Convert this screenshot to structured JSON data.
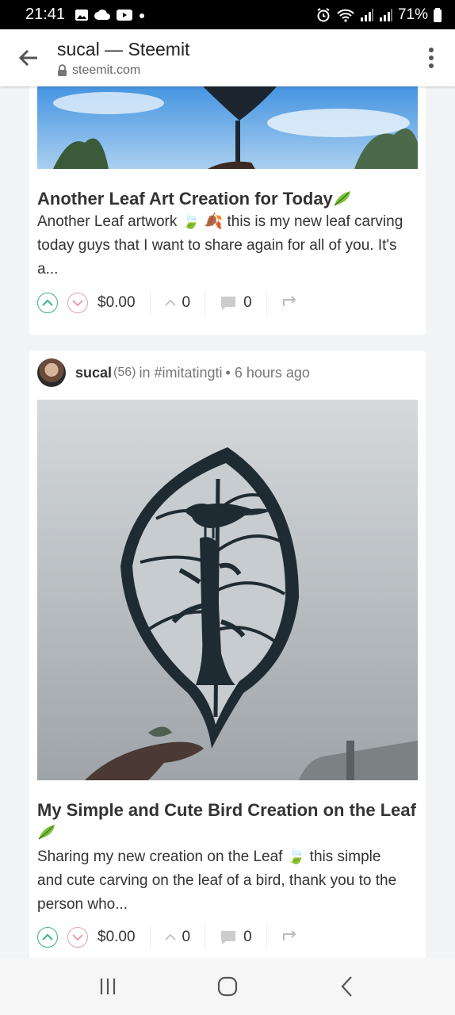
{
  "status_bar": {
    "time": "21:41",
    "battery": "71%"
  },
  "toolbar": {
    "title": "sucal — Steemit",
    "url": "steemit.com"
  },
  "posts": [
    {
      "title": "Another Leaf Art Creation for Today",
      "body": "Another Leaf artwork 🍃 🍂 this is my new leaf carving today guys that I want to share again for all of you. It's a...",
      "payout": "$0.00",
      "votes": "0",
      "comments": "0"
    },
    {
      "author": "sucal",
      "reputation": "(56)",
      "community": "in #imitatingti",
      "time": "• 6 hours ago",
      "title": "My Simple and Cute Bird Creation on the Leaf",
      "body": "Sharing my new creation on the Leaf 🍃 this simple and cute carving on the leaf of a bird, thank you to the person who...",
      "payout": "$0.00",
      "votes": "0",
      "comments": "0"
    }
  ],
  "colors": {
    "upvote": "#3bb08f",
    "downvote": "#e8a0a8",
    "sky": "#5aa0e0"
  }
}
